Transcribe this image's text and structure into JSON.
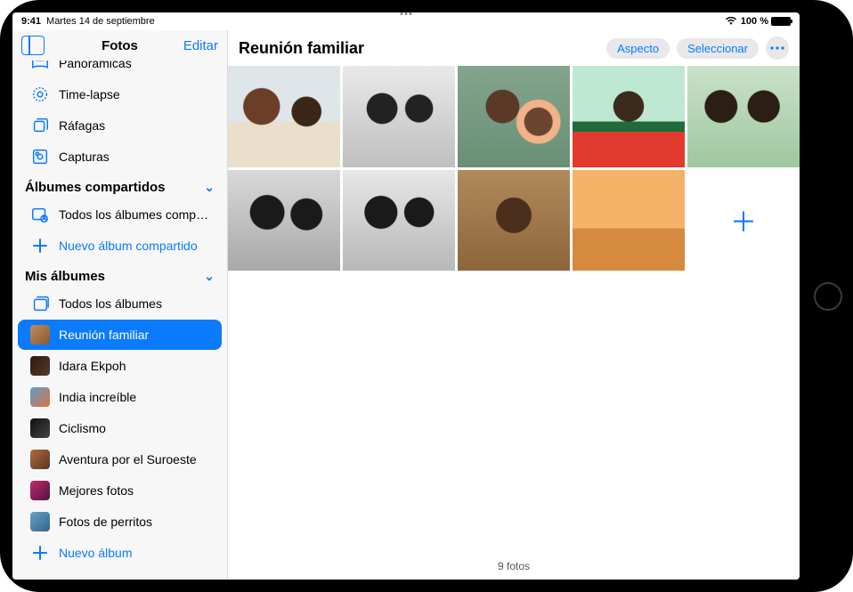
{
  "status": {
    "time": "9:41",
    "date": "Martes 14 de septiembre",
    "battery_pct": "100 %",
    "wifi_label": "WiFi"
  },
  "sidebar": {
    "title": "Fotos",
    "edit": "Editar",
    "media_types_partial": [
      {
        "label": "Panorámicas",
        "icon": "panorama"
      },
      {
        "label": "Time-lapse",
        "icon": "timelapse"
      },
      {
        "label": "Ráfagas",
        "icon": "burst"
      },
      {
        "label": "Capturas",
        "icon": "screenshot"
      }
    ],
    "shared": {
      "header": "Álbumes compartidos",
      "items": [
        {
          "label": "Todos los álbumes comp…",
          "icon": "shared-album"
        }
      ],
      "new_label": "Nuevo álbum compartido"
    },
    "my_albums": {
      "header": "Mis álbumes",
      "all_label": "Todos los álbumes",
      "items": [
        {
          "label": "Reunión familiar",
          "thumb": "t0",
          "selected": true
        },
        {
          "label": "Idara Ekpoh",
          "thumb": "t1"
        },
        {
          "label": "India increíble",
          "thumb": "t2"
        },
        {
          "label": "Ciclismo",
          "thumb": "t3"
        },
        {
          "label": "Aventura por el Suroeste",
          "thumb": "t4"
        },
        {
          "label": "Mejores fotos",
          "thumb": "t5"
        },
        {
          "label": "Fotos de perritos",
          "thumb": "t6"
        }
      ],
      "new_label": "Nuevo álbum"
    }
  },
  "main": {
    "title": "Reunión familiar",
    "aspect_btn": "Aspecto",
    "select_btn": "Seleccionar",
    "footer": "9 fotos",
    "photo_count": 9,
    "tiles": [
      "g-a",
      "g-b",
      "g-c",
      "g-d",
      "g-e",
      "g-f",
      "g-g",
      "g-h",
      "g-i"
    ]
  }
}
